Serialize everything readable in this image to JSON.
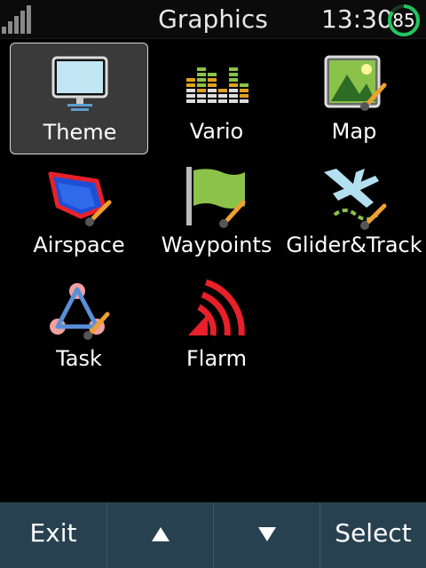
{
  "status_bar": {
    "title": "Graphics",
    "time": "13:30",
    "battery_percent": "85",
    "battery_level": 0.85,
    "signal_icon": "signal-bars-icon"
  },
  "menu": {
    "items": [
      {
        "label": "Theme",
        "icon": "monitor-icon",
        "selected": true
      },
      {
        "label": "Vario",
        "icon": "equalizer-bars-icon",
        "selected": false
      },
      {
        "label": "Map",
        "icon": "map-picture-icon",
        "selected": false
      },
      {
        "label": "Airspace",
        "icon": "airspace-polygon-icon",
        "selected": false
      },
      {
        "label": "Waypoints",
        "icon": "flag-icon",
        "selected": false
      },
      {
        "label": "Glider&Track",
        "icon": "glider-icon",
        "selected": false
      },
      {
        "label": "Task",
        "icon": "task-triangle-icon",
        "selected": false
      },
      {
        "label": "Flarm",
        "icon": "flarm-signal-icon",
        "selected": false
      }
    ]
  },
  "softkeys": {
    "exit": "Exit",
    "up_icon": "arrow-up-icon",
    "down_icon": "arrow-down-icon",
    "select": "Select"
  },
  "colors": {
    "softbar_bg": "#284150",
    "selected_tile_bg": "#3a3a3a",
    "battery_ring": "#22c55e",
    "brush_orange": "#f0a030"
  }
}
